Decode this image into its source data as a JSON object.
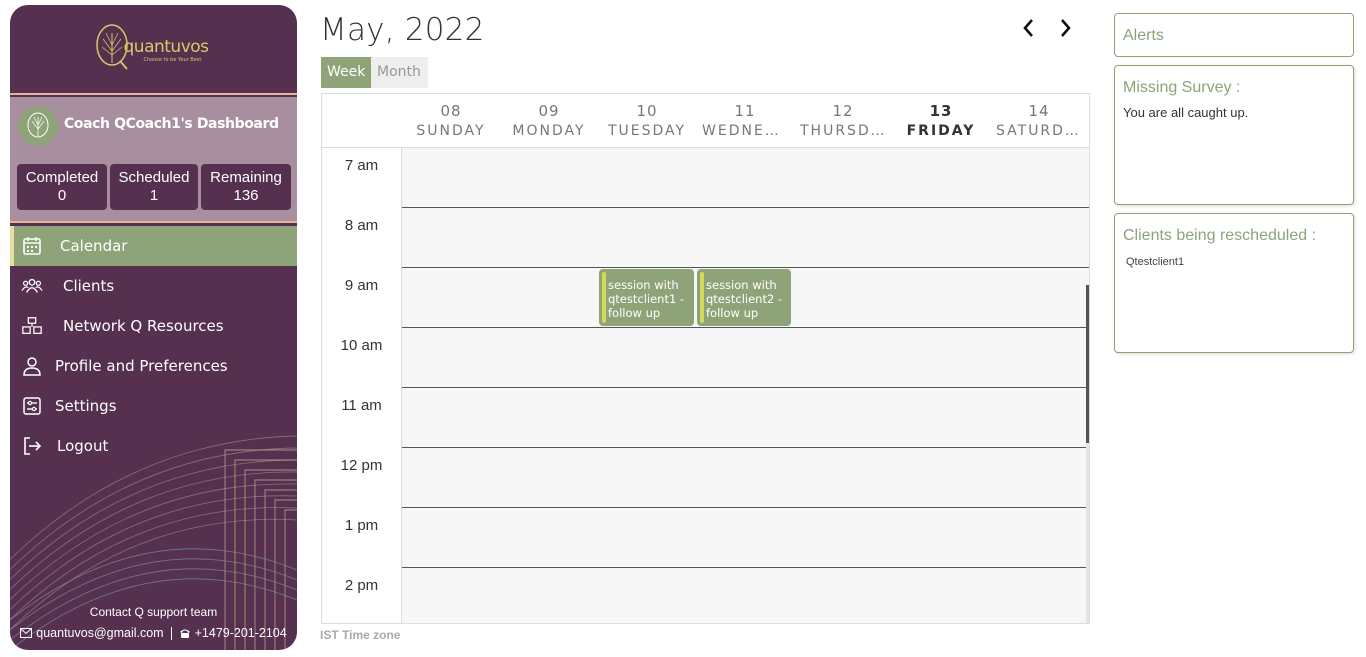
{
  "brand": {
    "name": "quantuvos",
    "tagline": "Choose to be Your Best",
    "logo_color": "#d8c86a"
  },
  "coach": {
    "title": "Coach QCoach1's Dashboard"
  },
  "stats": [
    {
      "label": "Completed",
      "value": "0"
    },
    {
      "label": "Scheduled",
      "value": "1"
    },
    {
      "label": "Remaining",
      "value": "136"
    }
  ],
  "nav": [
    {
      "label": "Calendar",
      "icon": "calendar-icon",
      "active": true
    },
    {
      "label": "Clients",
      "icon": "users-icon"
    },
    {
      "label": "Network Q Resources",
      "icon": "network-icon"
    },
    {
      "label": "Profile and Preferences",
      "icon": "user-icon"
    },
    {
      "label": "Settings",
      "icon": "settings-icon"
    },
    {
      "label": "Logout",
      "icon": "logout-icon"
    }
  ],
  "support": {
    "title": "Contact Q support team",
    "email": "quantuvos@gmail.com",
    "phone": "+1479-201-2104"
  },
  "calendar": {
    "title": "May, 2022",
    "views": [
      "Week",
      "Month"
    ],
    "active_view": "Week",
    "days": [
      {
        "num": "08",
        "name": "SUNDAY"
      },
      {
        "num": "09",
        "name": "MONDAY"
      },
      {
        "num": "10",
        "name": "TUESDAY"
      },
      {
        "num": "11",
        "name": "WEDNESDAY"
      },
      {
        "num": "12",
        "name": "THURSDAY"
      },
      {
        "num": "13",
        "name": "FRIDAY",
        "today": true
      },
      {
        "num": "14",
        "name": "SATURDAY"
      }
    ],
    "hours": [
      "7 am",
      "8 am",
      "9 am",
      "10 am",
      "11 am",
      "12 pm",
      "1 pm",
      "2 pm"
    ],
    "events": [
      {
        "day": "10",
        "hour": "9 am",
        "text": "session with qtestclient1 - follow up"
      },
      {
        "day": "11",
        "hour": "9 am",
        "text": "session with qtestclient2 - follow up"
      }
    ],
    "timezone": "IST Time zone"
  },
  "alerts": {
    "title": "Alerts",
    "missing_survey": {
      "title": "Missing Survey :",
      "text": "You are all caught up."
    },
    "rescheduled": {
      "title": "Clients being rescheduled :",
      "clients": [
        "Qtestclient1"
      ]
    }
  },
  "colors": {
    "sidebar": "#55304f",
    "accent_green": "#8fa378",
    "coach_panel": "#a78f9f",
    "band": "#e8b49a"
  }
}
